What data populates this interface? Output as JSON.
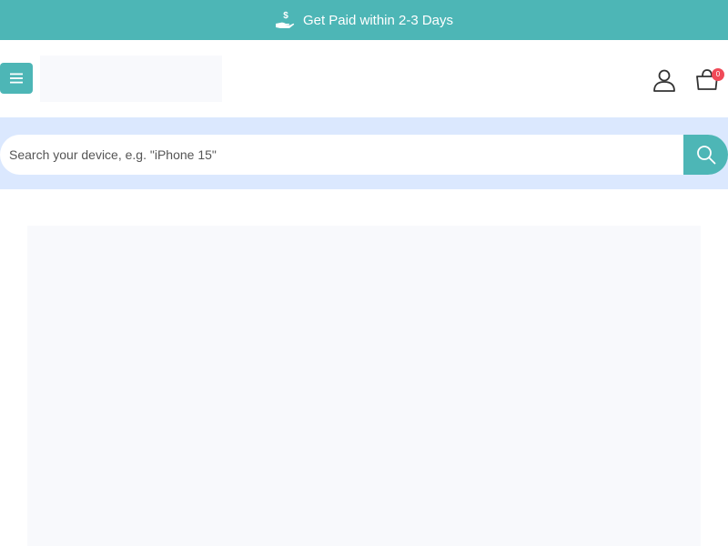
{
  "promo": {
    "icon": "hand-money-icon",
    "text": "Get Paid within 2-3 Days"
  },
  "header": {
    "menu_icon": "hamburger-icon",
    "account_icon": "user-icon",
    "cart_icon": "shopping-bag-icon",
    "cart_badge": "0"
  },
  "search": {
    "placeholder": "Search your device, e.g. \"iPhone 15\"",
    "value": "",
    "button_icon": "search-icon"
  },
  "colors": {
    "accent": "#4db6b6",
    "search_band": "#dbe8fe",
    "placeholder_block": "#f8f9fc",
    "badge": "#f04a58"
  }
}
